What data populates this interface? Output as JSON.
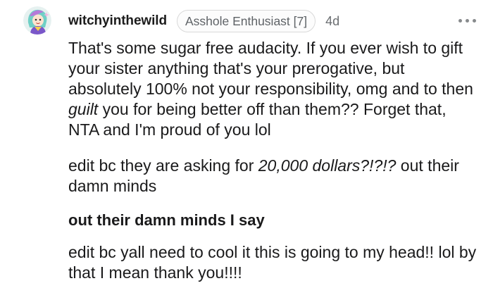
{
  "comment": {
    "username": "witchyinthewild",
    "flair": "Asshole Enthusiast [7]",
    "timestamp": "4d",
    "more_icon": "more-options-icon",
    "avatar_icon": "user-avatar-icon",
    "colors": {
      "username": "#1c1c1c",
      "meta": "#6a6d70",
      "text": "#1a1a1b",
      "flair_border": "#d9d9d9"
    },
    "paragraphs": {
      "p1": {
        "a": "That's some sugar free audacity. If you ever wish to gift your sister anything that's your prerogative, but absolutely 100% not your responsibility, omg and to then ",
        "em": "guilt",
        "b": " you for being better off than them?? Forget that, NTA and I'm proud of you lol"
      },
      "p2": {
        "a": "edit bc they are asking for ",
        "em": "20,000 dollars?!?!?",
        "b": " out their damn minds"
      },
      "p3": "out their damn minds I say",
      "p4": "edit bc yall need to cool it this is going to my head!! lol by that I mean thank you!!!!"
    }
  }
}
